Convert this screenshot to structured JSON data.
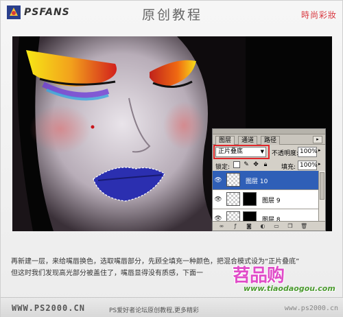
{
  "header": {
    "logo_text": "PSFANS",
    "title": "原创教程",
    "tag": "時尚彩妝"
  },
  "layers_panel": {
    "tabs": [
      "图层",
      "通道",
      "路径"
    ],
    "blend_mode": "正片叠底",
    "opacity_label": "不透明度:",
    "opacity_value": "100%",
    "lock_label": "锁定:",
    "fill_label": "填充:",
    "fill_value": "100%",
    "layers": [
      {
        "name": "图层 10",
        "selected": true
      },
      {
        "name": "图层 9",
        "selected": false
      },
      {
        "name": "图层 8",
        "selected": false
      }
    ]
  },
  "caption": {
    "line1": "再新建一层，来给嘴唇换色，选取嘴唇部分，先顾全填充一种颜色，把混合模式设为“正片叠底”",
    "line2": "但这时我们发现高光部分被盖住了，嘴唇显得没有质感，下面一"
  },
  "footer": {
    "url": "WWW.PS2000.CN",
    "note": "PS爱好者论坛原创教程,更多精彩",
    "url2": "www.ps2000.cn"
  },
  "watermark": {
    "text": "苕品购",
    "sub": "www.tiaodaogou.com"
  },
  "colors": {
    "header_tag": "#d9373f",
    "selected_layer": "#2f5fb7",
    "highlight_box": "#e0262a",
    "lip_blue": "#2b2fb0"
  }
}
